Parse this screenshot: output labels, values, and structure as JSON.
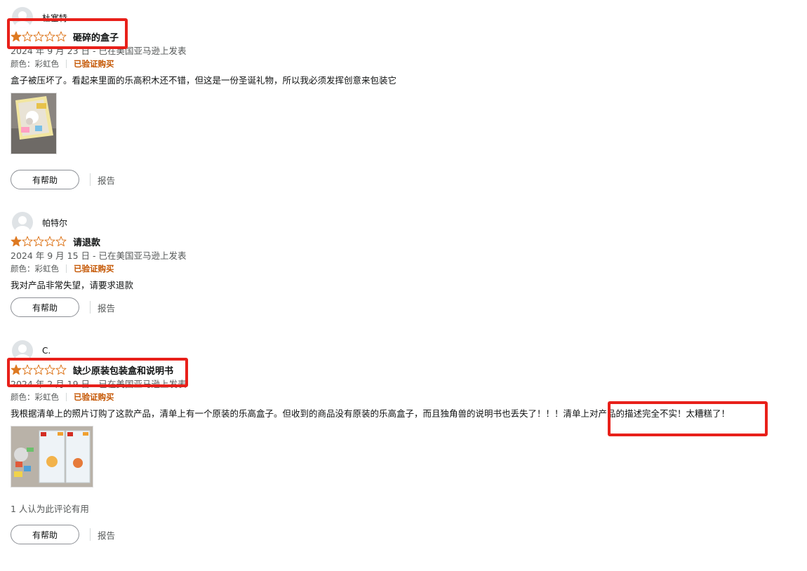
{
  "reviews": [
    {
      "reviewer": "杜塞特",
      "title": "砸碎的盒子",
      "rating": 1,
      "date": "2024 年 9 月 23 日 - 已在美国亚马逊上发表",
      "variant": "颜色：彩虹色",
      "verified": "已验证购买",
      "body": "盒子被压坏了。看起来里面的乐高积木还不错，但这是一份圣诞礼物，所以我必须发挥创意来包装它",
      "helpful_label": "有帮助",
      "report_label": "报告"
    },
    {
      "reviewer": "帕特尔",
      "title": "请退款",
      "rating": 1,
      "date": "2024 年 9 月 15 日 - 已在美国亚马逊上发表",
      "variant": "颜色：彩虹色",
      "verified": "已验证购买",
      "body": "我对产品非常失望，请要求退款",
      "helpful_label": "有帮助",
      "report_label": "报告"
    },
    {
      "reviewer": "C.",
      "title": "缺少原装包装盒和说明书",
      "rating": 1,
      "date": "2024 年 2 月 19 日 - 已在美国亚马逊上发表",
      "variant": "颜色：彩虹色",
      "verified": "已验证购买",
      "body": "我根据清单上的照片订购了这款产品，清单上有一个原装的乐高盒子。但收到的商品没有原装的乐高盒子，而且独角兽的说明书也丢失了！！！清单上对产品的描述完全不实！太糟糕了！",
      "helpful_count": "1 人认为此评论有用",
      "helpful_label": "有帮助",
      "report_label": "报告"
    }
  ],
  "colors": {
    "star": "#de7921",
    "verified": "#c45500",
    "highlight": "#e8201a"
  }
}
